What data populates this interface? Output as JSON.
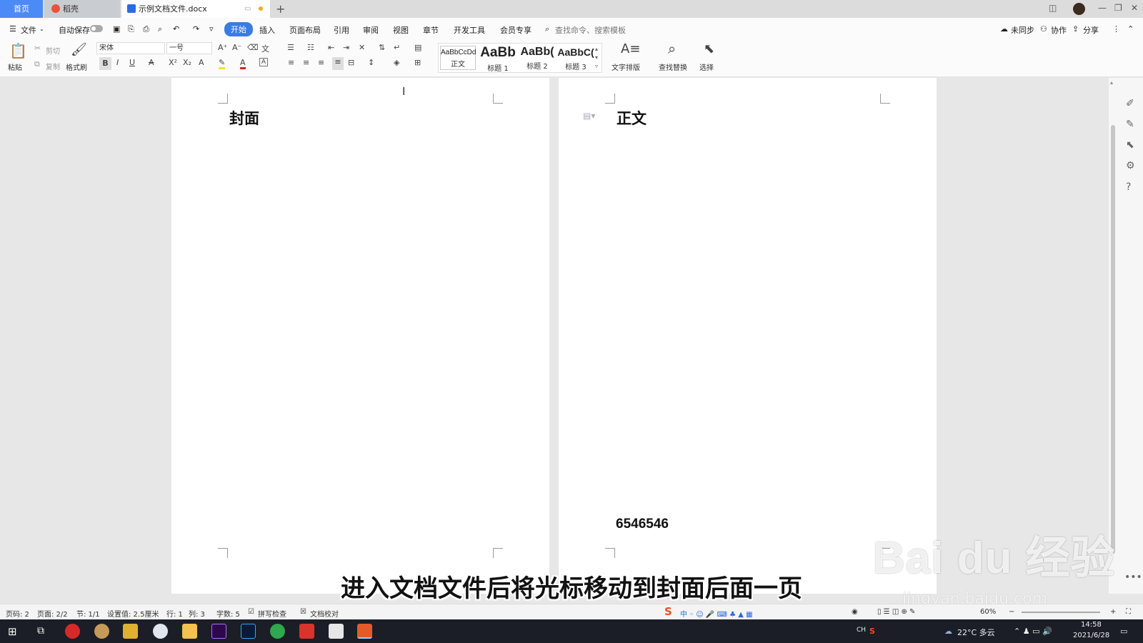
{
  "tabs": {
    "home": "首页",
    "daoke": "稻壳",
    "doc": "示例文档文件.docx",
    "new_tab": "+"
  },
  "menubar": {
    "file": "文件",
    "autosave": "自动保存",
    "start": "开始",
    "insert": "插入",
    "layout": "页面布局",
    "reference": "引用",
    "review": "审阅",
    "view": "视图",
    "chapter": "章节",
    "devtools": "开发工具",
    "member": "会员专享",
    "search_placeholder": "查找命令、搜索模板",
    "unsynced": "未同步",
    "collab": "协作",
    "share": "分享"
  },
  "ribbon": {
    "paste": "粘贴",
    "cut": "剪切",
    "copy": "复制",
    "format_painter": "格式刷",
    "font_name": "宋体",
    "font_size": "一号",
    "styles": [
      {
        "sample": "AaBbCcDd",
        "name": "正文"
      },
      {
        "sample": "AaBb",
        "name": "标题 1"
      },
      {
        "sample": "AaBb(",
        "name": "标题 2"
      },
      {
        "sample": "AaBbC(",
        "name": "标题 3"
      }
    ],
    "text_layout": "文字排版",
    "find_replace": "查找替换",
    "select": "选择"
  },
  "document": {
    "page1_title": "封面",
    "page2_title": "正文",
    "page2_footer_number": "6546546"
  },
  "subtitle": "进入文档文件后将光标移动到封面后面一页",
  "watermark": {
    "brand": "Bai du 经验",
    "url": "jingyan.baidu.com"
  },
  "statusbar": {
    "page_code": "页码: 2",
    "page": "页面: 2/2",
    "section": "节: 1/1",
    "setting": "设置值: 2.5厘米",
    "row": "行: 1",
    "col": "列: 3",
    "word_count": "字数: 5",
    "spell_check": "拼写检查",
    "doc_check": "文档校对",
    "zoom": "60%"
  },
  "taskbar": {
    "weather": "22°C 多云",
    "lang": "CH",
    "time": "14:58",
    "date": "2021/6/28"
  },
  "colors": {
    "accent": "#3a7be6",
    "home_tab": "#4c8bf5",
    "taskbar": "#1b1e26"
  }
}
